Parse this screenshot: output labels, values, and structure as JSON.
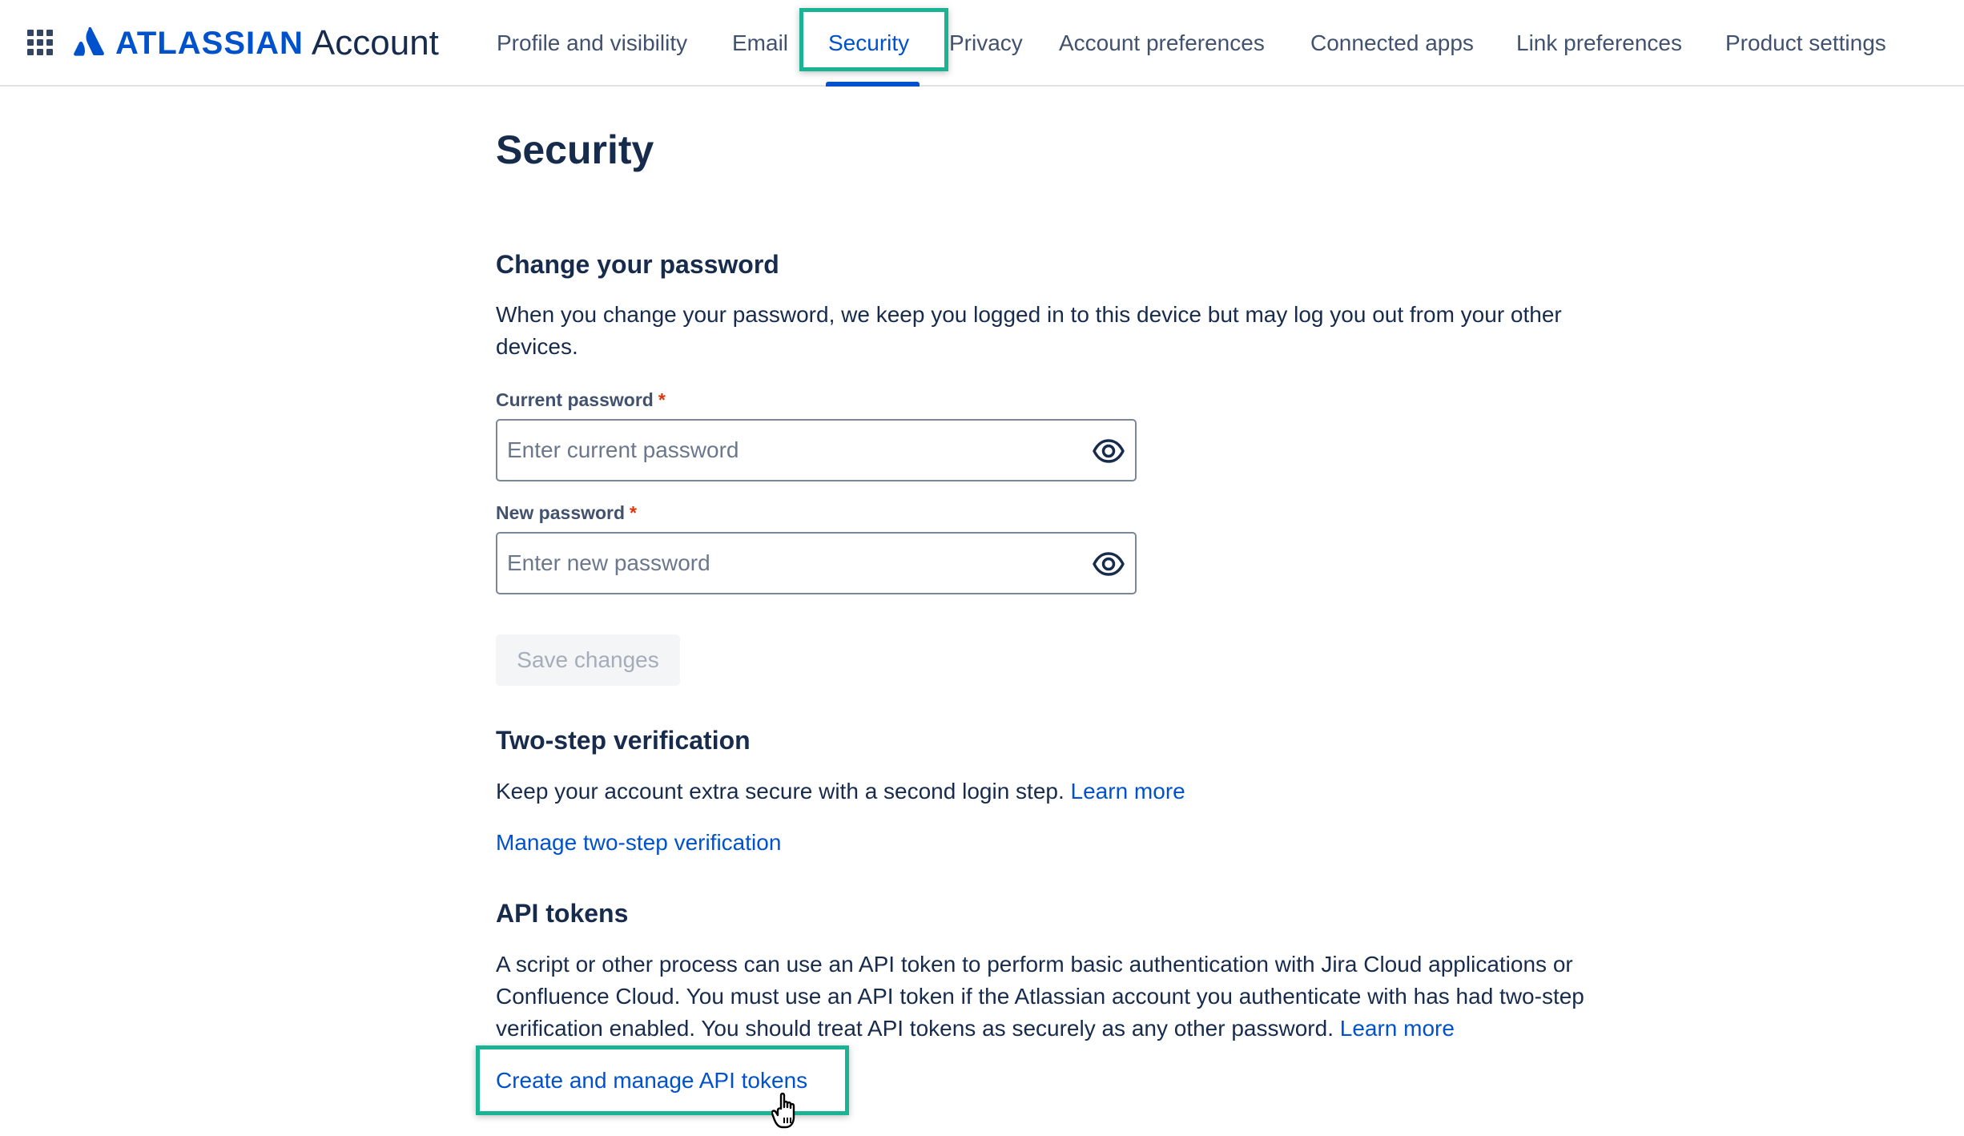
{
  "header": {
    "logo_word": "ATLASSIAN",
    "logo_product": "Account",
    "nav": [
      {
        "label": "Profile and visibility"
      },
      {
        "label": "Email"
      },
      {
        "label": "Security"
      },
      {
        "label": "Privacy"
      },
      {
        "label": "Account preferences"
      },
      {
        "label": "Connected apps"
      },
      {
        "label": "Link preferences"
      },
      {
        "label": "Product settings"
      }
    ],
    "active_tab": "Security"
  },
  "page": {
    "title": "Security"
  },
  "password": {
    "heading": "Change your password",
    "description": "When you change your password, we keep you logged in to this device but may log you out from your other devices.",
    "current_label": "Current password",
    "current_placeholder": "Enter current password",
    "new_label": "New password",
    "new_placeholder": "Enter new password",
    "required_mark": "*",
    "save_label": "Save changes"
  },
  "two_step": {
    "heading": "Two-step verification",
    "description": "Keep your account extra secure with a second login step.",
    "learn_more": "Learn more",
    "manage_link": "Manage two-step verification"
  },
  "api_tokens": {
    "heading": "API tokens",
    "description": "A script or other process can use an API token to perform basic authentication with Jira Cloud applications or Confluence Cloud. You must use an API token if the Atlassian account you authenticate with has had two-step verification enabled. You should treat API tokens as securely as any other password.",
    "learn_more": "Learn more",
    "manage_link": "Create and manage API tokens"
  },
  "colors": {
    "brand": "#0052cc",
    "text": "#172b4d",
    "highlight": "#1ab394",
    "required": "#de350b"
  },
  "icons": [
    "app-switcher-icon",
    "atlassian-logo-icon",
    "eye-icon",
    "hand-cursor-icon"
  ]
}
